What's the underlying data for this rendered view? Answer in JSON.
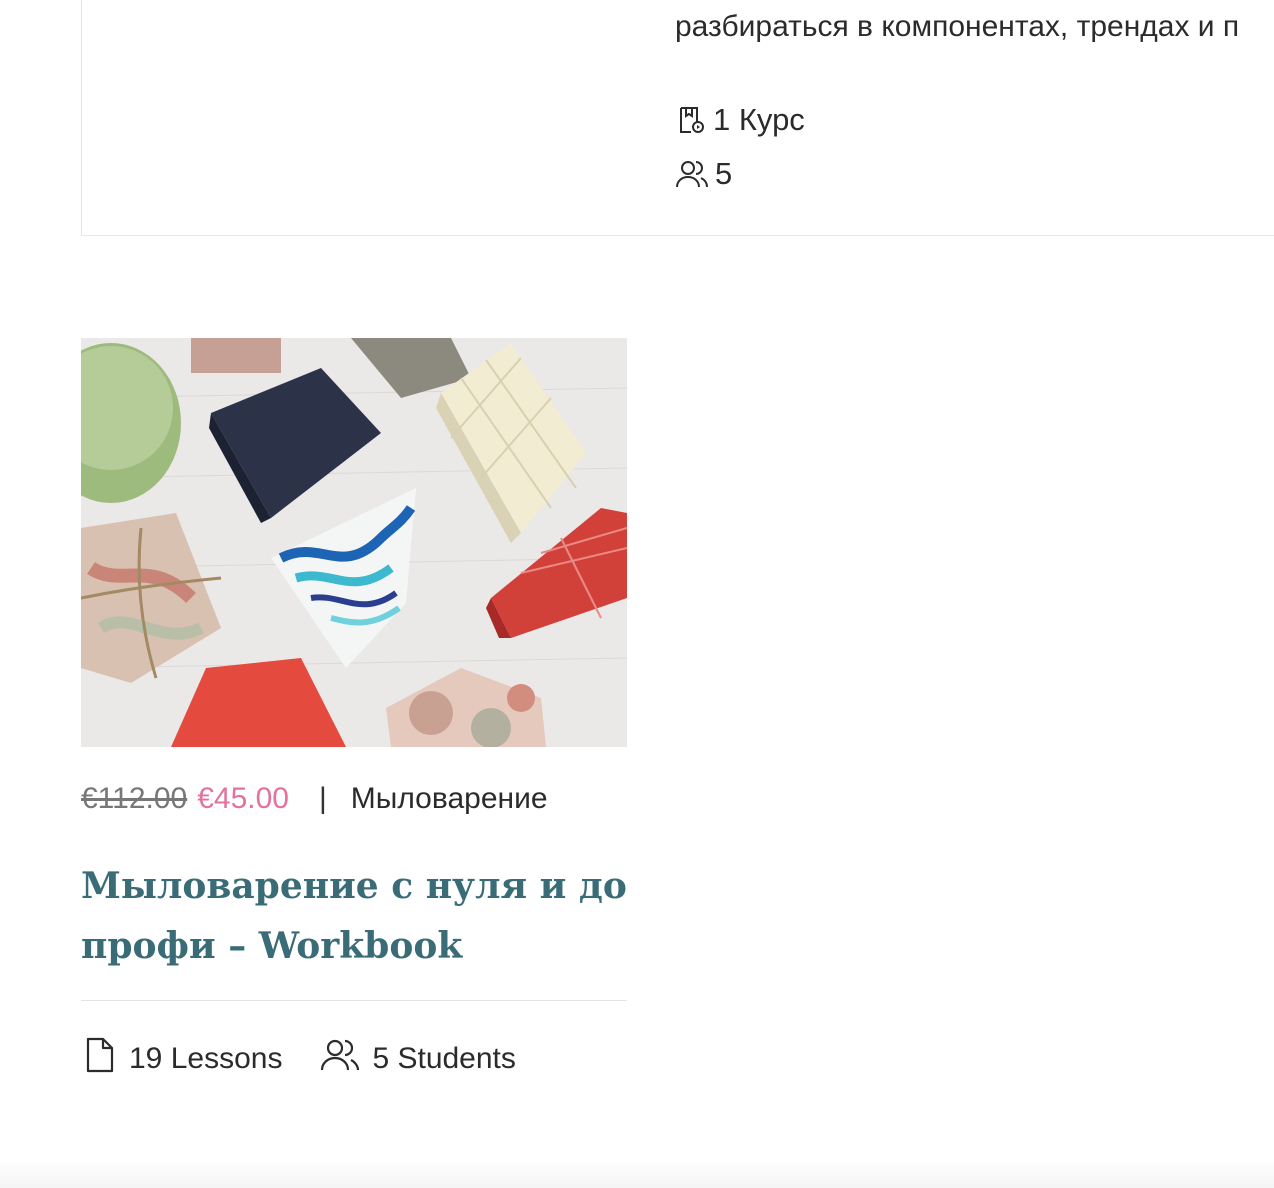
{
  "instructor_card": {
    "description": "разбираться в компонентах, трендах и п",
    "courses_count": "1 Курс",
    "students_count": "5",
    "icons": {
      "courses": "course-book-icon",
      "students": "users-icon"
    }
  },
  "course": {
    "image_alt": "soap bars",
    "price_old": "€112.00",
    "price_new": "€45.00",
    "separator": "|",
    "category": "Мыловарение",
    "title": "Мыловарение с нуля и до профи – Workbook",
    "lessons": "19 Lessons",
    "students": "5 Students",
    "icons": {
      "lessons": "document-icon",
      "students": "users-icon"
    }
  },
  "colors": {
    "accent_title": "#3a6c77",
    "sale_price": "#e3739e",
    "divider": "#e3e3e3"
  }
}
